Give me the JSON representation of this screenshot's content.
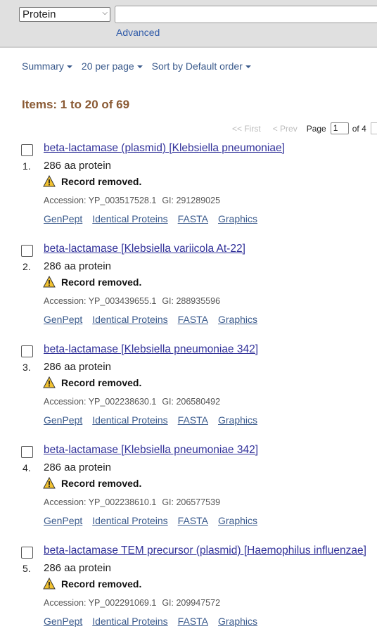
{
  "search": {
    "database": "Protein",
    "query": "",
    "advanced_label": "Advanced"
  },
  "toolbar": {
    "format": "Summary",
    "per_page": "20 per page",
    "sort": "Sort by Default order"
  },
  "results": {
    "items_label": "Items: 1 to 20 of 69",
    "pager": {
      "first": "<< First",
      "prev": "< Prev",
      "page_label": "Page",
      "page_value": "1",
      "of_pages": "of 4"
    }
  },
  "records": [
    {
      "number": "1.",
      "title": "beta-lactamase (plasmid) [Klebsiella pneumoniae]",
      "desc": "286 aa protein",
      "status": "Record removed.",
      "accession": "Accession: YP_003517528.1",
      "gi": "GI: 291289025"
    },
    {
      "number": "2.",
      "title": "beta-lactamase [Klebsiella variicola At-22]",
      "desc": "286 aa protein",
      "status": "Record removed.",
      "accession": "Accession: YP_003439655.1",
      "gi": "GI: 288935596"
    },
    {
      "number": "3.",
      "title": "beta-lactamase [Klebsiella pneumoniae 342]",
      "desc": "286 aa protein",
      "status": "Record removed.",
      "accession": "Accession: YP_002238630.1",
      "gi": "GI: 206580492"
    },
    {
      "number": "4.",
      "title": "beta-lactamase [Klebsiella pneumoniae 342]",
      "desc": "286 aa protein",
      "status": "Record removed.",
      "accession": "Accession: YP_002238610.1",
      "gi": "GI: 206577539"
    },
    {
      "number": "5.",
      "title": "beta-lactamase TEM precursor (plasmid) [Haemophilus influenzae]",
      "desc": "286 aa protein",
      "status": "Record removed.",
      "accession": "Accession: YP_002291069.1",
      "gi": "GI: 209947572"
    }
  ],
  "record_links": {
    "genpept": "GenPept",
    "identical": "Identical Proteins",
    "fasta": "FASTA",
    "graphics": "Graphics"
  },
  "icons": {
    "warning": "warning-triangle-icon",
    "caret": "caret-down-icon"
  }
}
